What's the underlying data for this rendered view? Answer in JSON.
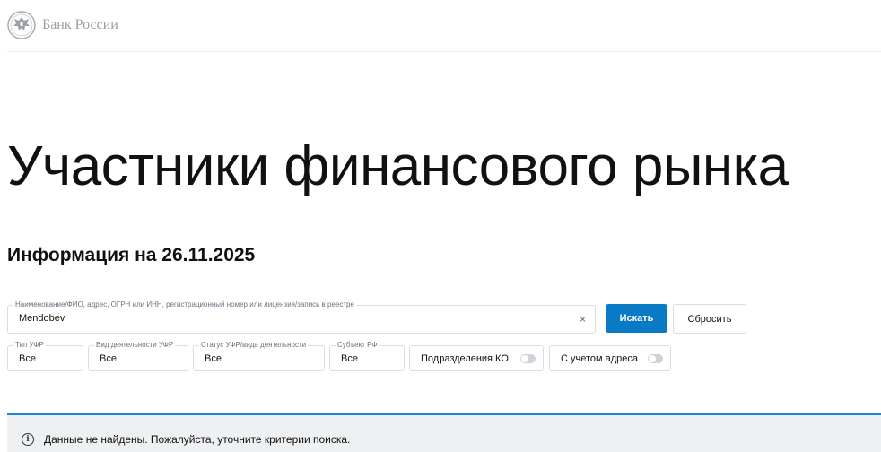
{
  "header": {
    "brand": "Банк России",
    "logo_icon": "eagle-emblem-icon"
  },
  "main": {
    "title": "Участники финансового рынка",
    "info_date": "Информация на 26.11.2025"
  },
  "search": {
    "label": "Наименование/ФИО, адрес, ОГРН или ИНН, регистрационный номер или лицензия/запись в реестре",
    "value": "Mendobev",
    "clear_symbol": "×",
    "submit_label": "Искать",
    "reset_label": "Сбросить"
  },
  "filters": [
    {
      "label": "Тип УФР",
      "value": "Все"
    },
    {
      "label": "Вид деятельности УФР",
      "value": "Все"
    },
    {
      "label": "Статус УФР/вида деятельности",
      "value": "Все"
    },
    {
      "label": "Субъект РФ",
      "value": "Все"
    }
  ],
  "toggles": [
    {
      "label": "Подразделения КО",
      "enabled": false
    },
    {
      "label": "С учетом адреса",
      "enabled": false
    }
  ],
  "notice": {
    "icon": "info-icon",
    "icon_symbol": "i",
    "text": "Данные не найдены. Пожалуйста, уточните критерии поиска."
  },
  "colors": {
    "primary": "#0a7ac6",
    "notice_border": "#1f86d8",
    "notice_bg": "#eef0f2",
    "brand_text": "#9aa0a6"
  }
}
